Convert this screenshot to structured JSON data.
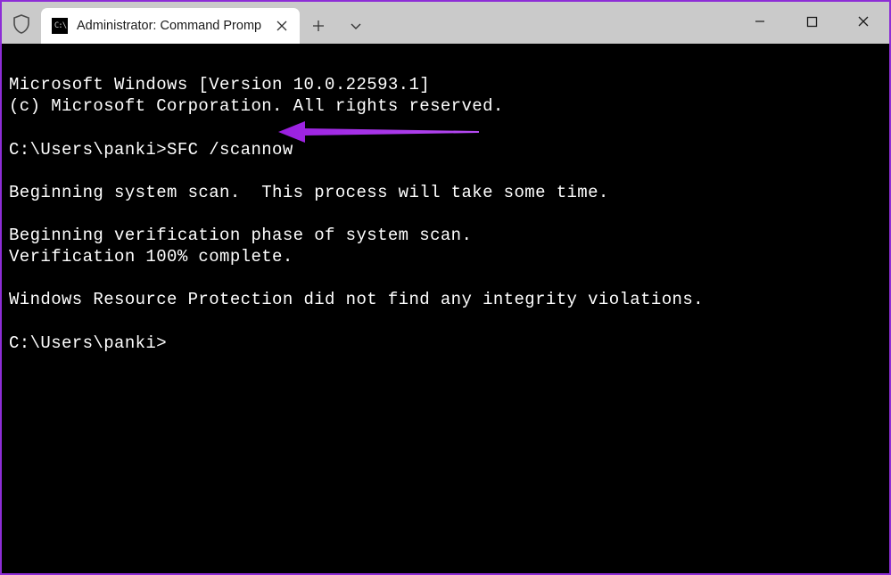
{
  "tab": {
    "title": "Administrator: Command Promp"
  },
  "terminal": {
    "line1": "Microsoft Windows [Version 10.0.22593.1]",
    "line2": "(c) Microsoft Corporation. All rights reserved.",
    "blank1": "",
    "prompt1_path": "C:\\Users\\panki>",
    "prompt1_cmd": "SFC /scannow",
    "blank2": "",
    "line3": "Beginning system scan.  This process will take some time.",
    "blank3": "",
    "line4": "Beginning verification phase of system scan.",
    "line5": "Verification 100% complete.",
    "blank4": "",
    "line6": "Windows Resource Protection did not find any integrity violations.",
    "blank5": "",
    "prompt2": "C:\\Users\\panki>"
  },
  "colors": {
    "accent_purple": "#9a1fe0"
  }
}
